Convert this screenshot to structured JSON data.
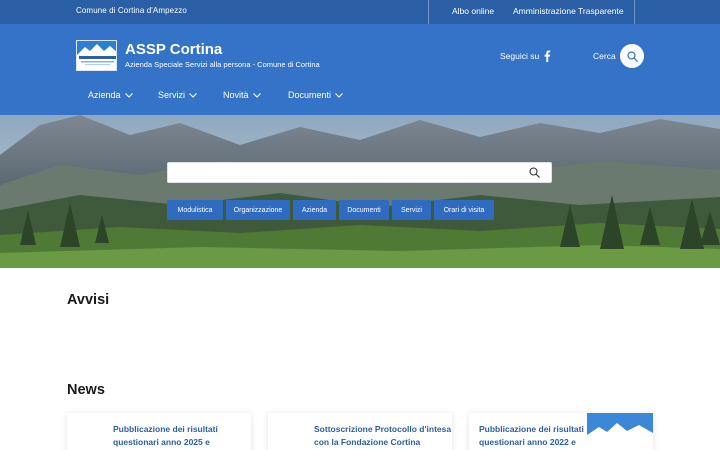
{
  "topbar": {
    "organization": "Comune di Cortina d'Ampezzo",
    "links": [
      "Albo online",
      "Amministrazione Trasparente"
    ]
  },
  "header": {
    "title": "ASSP Cortina",
    "subtitle": "Azienda Speciale Servizi alla persona - Comune di Cortina",
    "social_label": "Seguici su",
    "social_icon": "facebook-icon",
    "search_label": "Cerca",
    "search_icon": "search-icon",
    "brand_color": "#3473c7",
    "topbar_color": "#2a5ea5"
  },
  "nav": {
    "items": [
      {
        "label": "Azienda"
      },
      {
        "label": "Servizi"
      },
      {
        "label": "Novità"
      },
      {
        "label": "Documenti"
      }
    ]
  },
  "hero": {
    "search_placeholder": "",
    "search_value": "",
    "chips": [
      "Modulistica",
      "Organizzazione",
      "Azienda",
      "Documenti",
      "Servizi",
      "Orari di visita"
    ],
    "chip_color": "#2f6bc0"
  },
  "sections": {
    "avvisi_title": "Avvisi",
    "news_title": "News"
  },
  "news": [
    {
      "title_line1": "Pubblicazione dei risultati",
      "title_line2": "questionari anno 2025 e"
    },
    {
      "title_line1": "Sottoscrizione Protocollo d'intesa",
      "title_line2": "con la Fondazione Cortina"
    },
    {
      "title_line1": "Pubblicazione dei risultati",
      "title_line2": "questionari anno 2022 e"
    }
  ]
}
